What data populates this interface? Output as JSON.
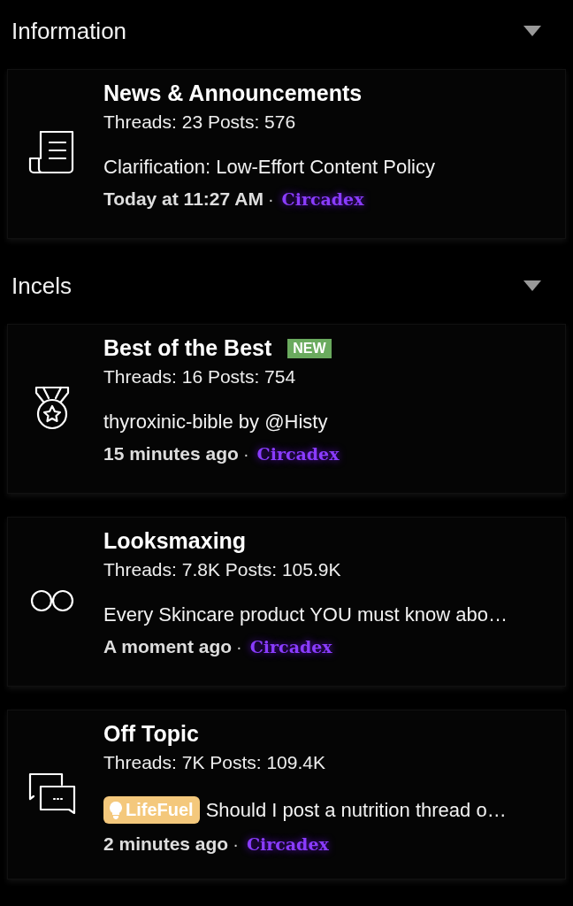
{
  "sections": [
    {
      "title": "Information",
      "forums": [
        {
          "title": "News & Announcements",
          "stats": "Threads: 23 Posts: 576",
          "latest": "Clarification: Low-Effort Content Policy",
          "time": "Today at 11:27 AM",
          "separator": "·",
          "user": "Circadex"
        }
      ]
    },
    {
      "title": "Incels",
      "forums": [
        {
          "title": "Best of the Best",
          "badge": "NEW",
          "stats": "Threads: 16 Posts: 754",
          "latest": "thyroxinic-bible by @Histy",
          "time": "15 minutes ago",
          "separator": "·",
          "user": "Circadex"
        },
        {
          "title": "Looksmaxing",
          "stats": "Threads: 7.8K Posts: 105.9K",
          "latest": "Every Skincare product YOU must know abo…",
          "time": "A moment ago",
          "separator": "·",
          "user": "Circadex"
        },
        {
          "title": "Off Topic",
          "stats": "Threads: 7K Posts: 109.4K",
          "prefix": "LifeFuel",
          "latest": "Should I post a nutrition thread o…",
          "time": "2 minutes ago",
          "separator": "·",
          "user": "Circadex"
        }
      ]
    }
  ]
}
